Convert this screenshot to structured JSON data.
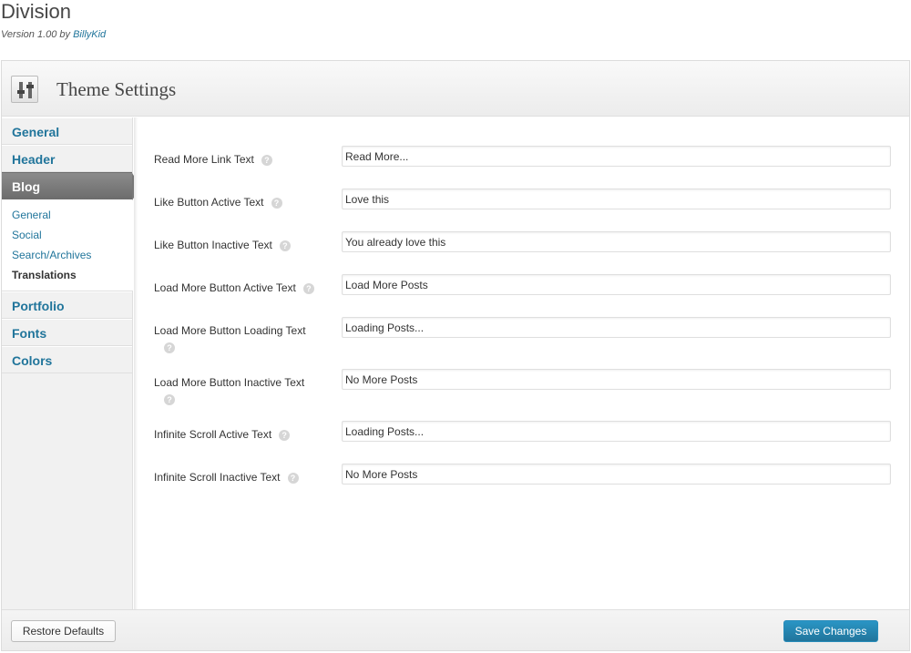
{
  "page": {
    "theme_name": "Division",
    "version_text": "Version 1.00 by",
    "author": "BillyKid"
  },
  "panel": {
    "title": "Theme Settings",
    "icon": "sliders-icon"
  },
  "sidebar": {
    "items": [
      {
        "label": "General"
      },
      {
        "label": "Header"
      },
      {
        "label": "Blog"
      },
      {
        "label": "Portfolio"
      },
      {
        "label": "Fonts"
      },
      {
        "label": "Colors"
      }
    ],
    "active": "Blog",
    "sub_items": [
      {
        "label": "General"
      },
      {
        "label": "Social"
      },
      {
        "label": "Search/Archives"
      },
      {
        "label": "Translations"
      }
    ],
    "current_sub": "Translations"
  },
  "fields": [
    {
      "label": "Read More Link Text",
      "value": "Read More..."
    },
    {
      "label": "Like Button Active Text",
      "value": "Love this"
    },
    {
      "label": "Like Button Inactive Text",
      "value": "You already love this"
    },
    {
      "label": "Load More Button Active Text",
      "value": "Load More Posts"
    },
    {
      "label": "Load More Button Loading Text",
      "value": "Loading Posts..."
    },
    {
      "label": "Load More Button Inactive Text",
      "value": "No More Posts"
    },
    {
      "label": "Infinite Scroll Active Text",
      "value": "Loading Posts..."
    },
    {
      "label": "Infinite Scroll Inactive Text",
      "value": "No More Posts"
    }
  ],
  "help_glyph": "?",
  "footer": {
    "restore_label": "Restore Defaults",
    "save_label": "Save Changes"
  },
  "colors": {
    "link": "#21759b",
    "active_nav": "#777777",
    "primary_button": "#21759b"
  }
}
